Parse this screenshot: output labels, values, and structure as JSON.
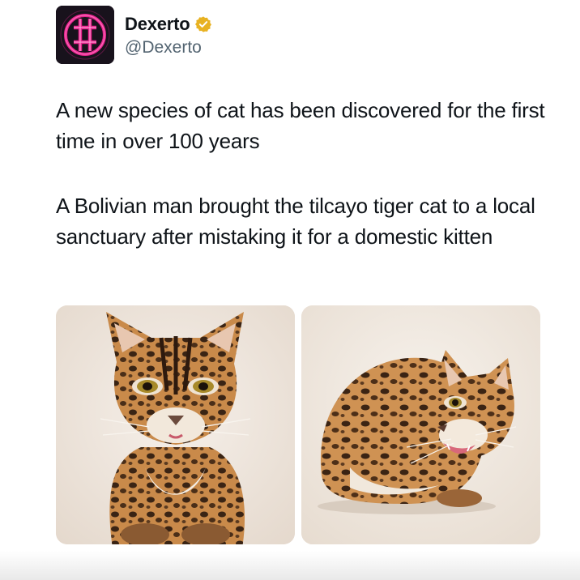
{
  "author": {
    "display_name": "Dexerto",
    "handle": "@Dexerto",
    "verified": true,
    "avatar_icon": "dexerto-logo-icon",
    "verified_icon": "verified-badge-icon",
    "badge_color": "#e8b222",
    "logo_color": "#e8258f"
  },
  "tweet": {
    "paragraph_1": "A new species of cat has been discovered for the first time in over 100 years",
    "paragraph_2": "A Bolivian man brought the tilcayo tiger cat to a local sanctuary after mistaking it for a domestic kitten"
  },
  "media": {
    "count": 2,
    "images": [
      {
        "subject": "tiger-cat-sitting-front-view"
      },
      {
        "subject": "tiger-cat-crouching-hissing"
      }
    ]
  }
}
